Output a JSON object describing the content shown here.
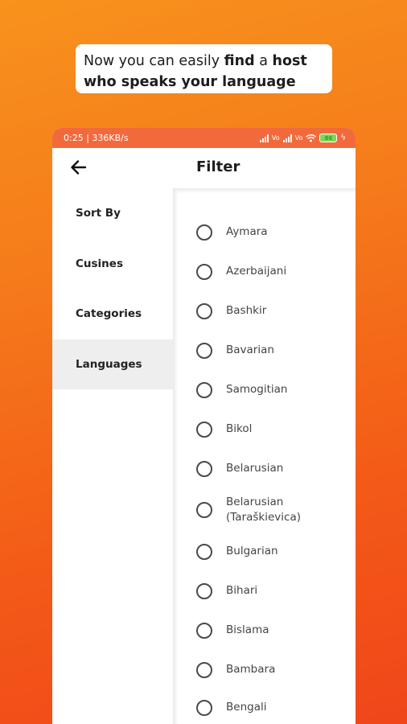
{
  "caption": {
    "line1_pre": "Now you can easily ",
    "line1_b1": "find",
    "line1_mid": " a ",
    "line1_b2": "host",
    "line2": "who speaks your language"
  },
  "status_bar": {
    "time_speed": "0:25 | 336KB/s",
    "vo1": "Vo",
    "vo2": "Vo",
    "battery": "86"
  },
  "app_bar": {
    "title": "Filter"
  },
  "sidebar": {
    "items": [
      {
        "label": "Sort By",
        "active": false
      },
      {
        "label": "Cusines",
        "active": false
      },
      {
        "label": "Categories",
        "active": false
      },
      {
        "label": "Languages",
        "active": true
      }
    ]
  },
  "languages": [
    "Aymara",
    "Azerbaijani",
    "Bashkir",
    "Bavarian",
    "Samogitian",
    "Bikol",
    "Belarusian",
    "Belarusian (Taraškievica)",
    "Bulgarian",
    "Bihari",
    "Bislama",
    "Bambara",
    "Bengali"
  ],
  "colors": {
    "accent": "#f26a3c",
    "background_top": "#f8921c",
    "background_bottom": "#f0461a"
  }
}
